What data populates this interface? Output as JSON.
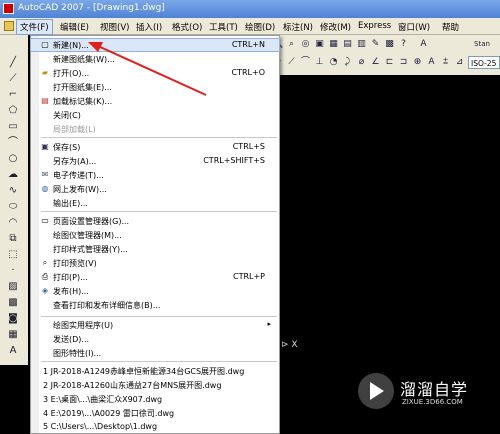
{
  "window": {
    "title": "AutoCAD 2007 - [Drawing1.dwg]"
  },
  "menubar": {
    "items": [
      "文件(F)",
      "编辑(E)",
      "视图(V)",
      "插入(I)",
      "格式(O)",
      "工具(T)",
      "绘图(D)",
      "标注(N)",
      "修改(M)",
      "Express",
      "窗口(W)",
      "帮助"
    ]
  },
  "toolbar": {
    "text_style": "ISO-25",
    "style_label": "Stan"
  },
  "file_menu": {
    "items": [
      {
        "label": "新建(N)...",
        "shortcut": "CTRL+N"
      },
      {
        "label": "新建图纸集(W)...",
        "shortcut": ""
      },
      {
        "label": "打开(O)...",
        "shortcut": "CTRL+O"
      },
      {
        "label": "打开图纸集(E)...",
        "shortcut": ""
      },
      {
        "label": "加载标记集(K)...",
        "shortcut": ""
      },
      {
        "label": "关闭(C)",
        "shortcut": ""
      },
      {
        "label": "局部加载(L)",
        "shortcut": ""
      },
      {
        "label": "保存(S)",
        "shortcut": "CTRL+S"
      },
      {
        "label": "另存为(A)...",
        "shortcut": "CTRL+SHIFT+S"
      },
      {
        "label": "电子传递(T)...",
        "shortcut": ""
      },
      {
        "label": "网上发布(W)...",
        "shortcut": ""
      },
      {
        "label": "输出(E)...",
        "shortcut": ""
      },
      {
        "label": "页面设置管理器(G)...",
        "shortcut": ""
      },
      {
        "label": "绘图仪管理器(M)...",
        "shortcut": ""
      },
      {
        "label": "打印样式管理器(Y)...",
        "shortcut": ""
      },
      {
        "label": "打印预览(V)",
        "shortcut": ""
      },
      {
        "label": "打印(P)...",
        "shortcut": "CTRL+P"
      },
      {
        "label": "发布(H)...",
        "shortcut": ""
      },
      {
        "label": "查看打印和发布详细信息(B)...",
        "shortcut": ""
      },
      {
        "label": "绘图实用程序(U)",
        "shortcut": ""
      },
      {
        "label": "发送(D)...",
        "shortcut": ""
      },
      {
        "label": "图形特性(I)...",
        "shortcut": ""
      },
      {
        "label": "1 JR-2018-A1249赤峰卓恒新能源34台GCS展开图.dwg",
        "shortcut": ""
      },
      {
        "label": "2 JR-2018-A1260山东通益27台MNS展开图.dwg",
        "shortcut": ""
      },
      {
        "label": "3 E:\\桌面\\...\\曲梁汇众X907.dwg",
        "shortcut": ""
      },
      {
        "label": "4 E:\\2019\\...\\A0029 雷口徐司.dwg",
        "shortcut": ""
      },
      {
        "label": "5 C:\\Users\\...\\Desktop\\1.dwg",
        "shortcut": ""
      }
    ]
  },
  "canvas": {
    "ucs_label": "X"
  },
  "watermark": {
    "name": "溜溜自学",
    "url": "ZIXUE.3D66.COM"
  },
  "colors": {
    "annotation_arrow": "#e0201c",
    "menu_highlight": "#dbe6f6"
  }
}
